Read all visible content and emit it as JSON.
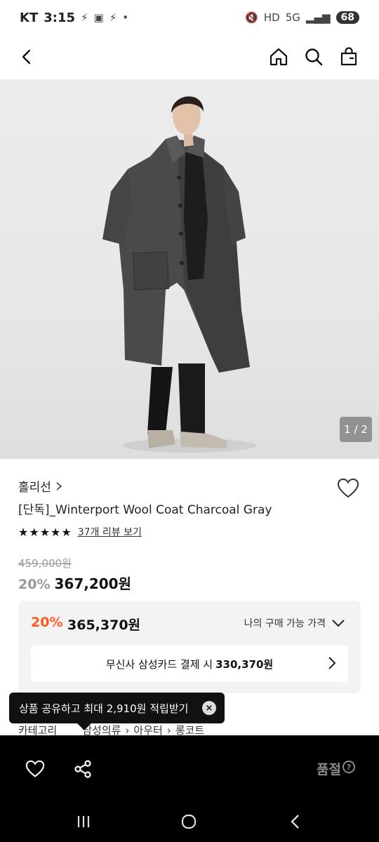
{
  "status_bar": {
    "carrier": "KT",
    "time": "3:15",
    "battery": "68"
  },
  "nav": {
    "back_icon": "chevron-left-icon",
    "home_icon": "home-icon",
    "search_icon": "search-icon",
    "cart_icon": "bag-icon"
  },
  "gallery": {
    "counter": "1 / 2"
  },
  "product": {
    "brand": "홀리선",
    "title": "[단독]_Winterport Wool Coat Charcoal Gray",
    "stars": "★★★★★",
    "review_link": "37개 리뷰 보기",
    "original_price": "459,000원",
    "discount": "20%",
    "price": "367,200원"
  },
  "buy_box": {
    "discount": "20%",
    "price": "365,370원",
    "toggle_label": "나의 구매 가능 가격",
    "card_text": "무신사 삼성카드 결제 시",
    "card_price": "330,370원"
  },
  "category": {
    "label": "카테고리",
    "path": [
      "남성의류",
      "아우터",
      "롱코트"
    ]
  },
  "toast": {
    "text": "상품 공유하고 최대 2,910원 적립받기",
    "close": "×"
  },
  "bottom_bar": {
    "soldout": "품절",
    "help": "?"
  },
  "colors": {
    "accent": "#ff5a1f",
    "dark": "#000000"
  }
}
